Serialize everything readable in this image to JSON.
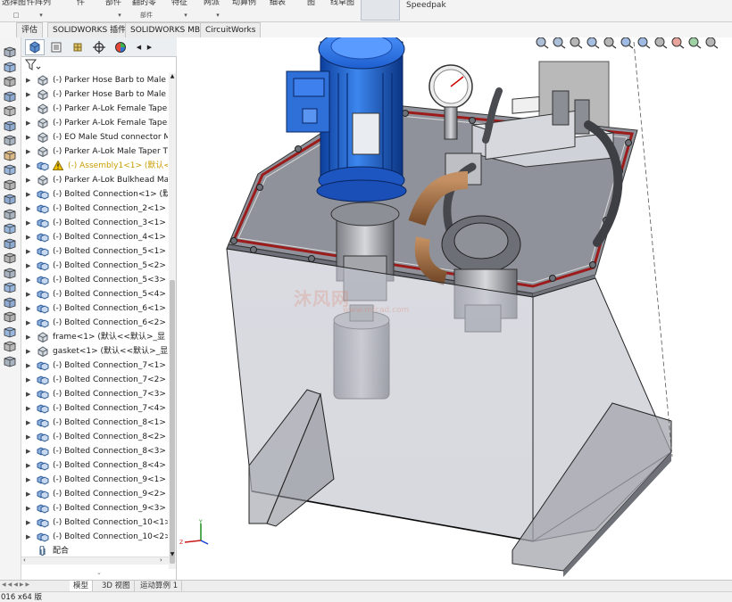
{
  "ribbon": {
    "items": [
      {
        "text": "选择图",
        "sub": "□"
      },
      {
        "text": "件阵列",
        "sub": "▾"
      },
      {
        "text": "件",
        "sub": ""
      },
      {
        "text": "部件",
        "sub": "▾"
      },
      {
        "text": "翻的零",
        "sub": "部件"
      },
      {
        "text": "特征",
        "sub": "▾"
      },
      {
        "text": "网派",
        "sub": "▾"
      },
      {
        "text": "动算例",
        "sub": ""
      },
      {
        "text": "细表",
        "sub": ""
      },
      {
        "text": "图",
        "sub": ""
      },
      {
        "text": "线草图",
        "sub": ""
      },
      {
        "text": "Speedpak",
        "sub": ""
      }
    ]
  },
  "tabs": [
    "评估",
    "SOLIDWORKS 插件",
    "SOLIDWORKS MBD",
    "CircuitWorks"
  ],
  "tree": [
    {
      "label": "(-) Parker Hose Barb to Male",
      "icon": "part",
      "warn": false
    },
    {
      "label": "(-) Parker Hose Barb to Male",
      "icon": "part",
      "warn": false
    },
    {
      "label": "(-) Parker A-Lok Female Taper",
      "icon": "part",
      "warn": false
    },
    {
      "label": "(-) Parker A-Lok Female Taper",
      "icon": "part",
      "warn": false
    },
    {
      "label": "(-) EO Male Stud connector M",
      "icon": "part",
      "warn": false
    },
    {
      "label": "(-) Parker A-Lok Male Taper T",
      "icon": "part",
      "warn": false
    },
    {
      "label": "(-) Assembly1<1> (默认<默",
      "icon": "asm",
      "warn": true
    },
    {
      "label": "(-) Parker A-Lok Bulkhead Ma",
      "icon": "part",
      "warn": false
    },
    {
      "label": "(-) Bolted Connection<1> (默认",
      "icon": "asm",
      "warn": false
    },
    {
      "label": "(-) Bolted Connection_2<1> (默",
      "icon": "asm",
      "warn": false
    },
    {
      "label": "(-) Bolted Connection_3<1> (默",
      "icon": "asm",
      "warn": false
    },
    {
      "label": "(-) Bolted Connection_4<1> (默",
      "icon": "asm",
      "warn": false
    },
    {
      "label": "(-) Bolted Connection_5<1> (默",
      "icon": "asm",
      "warn": false
    },
    {
      "label": "(-) Bolted Connection_5<2> (默",
      "icon": "asm",
      "warn": false
    },
    {
      "label": "(-) Bolted Connection_5<3> (默",
      "icon": "asm",
      "warn": false
    },
    {
      "label": "(-) Bolted Connection_5<4> (默",
      "icon": "asm",
      "warn": false
    },
    {
      "label": "(-) Bolted Connection_6<1> (默",
      "icon": "asm",
      "warn": false
    },
    {
      "label": "(-) Bolted Connection_6<2> (默",
      "icon": "asm",
      "warn": false
    },
    {
      "label": "frame<1> (默认<<默认>_显",
      "icon": "part",
      "warn": false
    },
    {
      "label": "gasket<1> (默认<<默认>_显",
      "icon": "part",
      "warn": false
    },
    {
      "label": "(-) Bolted Connection_7<1> (默",
      "icon": "asm",
      "warn": false
    },
    {
      "label": "(-) Bolted Connection_7<2> (默",
      "icon": "asm",
      "warn": false
    },
    {
      "label": "(-) Bolted Connection_7<3> (默",
      "icon": "asm",
      "warn": false
    },
    {
      "label": "(-) Bolted Connection_7<4> (默",
      "icon": "asm",
      "warn": false
    },
    {
      "label": "(-) Bolted Connection_8<1> (默",
      "icon": "asm",
      "warn": false
    },
    {
      "label": "(-) Bolted Connection_8<2> (默",
      "icon": "asm",
      "warn": false
    },
    {
      "label": "(-) Bolted Connection_8<3> (默",
      "icon": "asm",
      "warn": false
    },
    {
      "label": "(-) Bolted Connection_8<4> (默",
      "icon": "asm",
      "warn": false
    },
    {
      "label": "(-) Bolted Connection_9<1> (默",
      "icon": "asm",
      "warn": false
    },
    {
      "label": "(-) Bolted Connection_9<2> (默",
      "icon": "asm",
      "warn": false
    },
    {
      "label": "(-) Bolted Connection_9<3> (默",
      "icon": "asm",
      "warn": false
    },
    {
      "label": "(-) Bolted Connection_10<1>",
      "icon": "asm",
      "warn": false
    },
    {
      "label": "(-) Bolted Connection_10<2>",
      "icon": "asm",
      "warn": false
    },
    {
      "label": "配合",
      "icon": "mates",
      "warn": false
    }
  ],
  "sheet_tabs": [
    "模型",
    "3D 视图",
    "运动算例 1"
  ],
  "status": "016 x64 版",
  "watermark": {
    "main": "沐风网",
    "sub": "www.mfcad.com"
  },
  "colors": {
    "motor": "#2a6fd6",
    "frame": "#9ea0a8",
    "gasket": "#a31d1d",
    "brass": "#9b6b3a"
  }
}
